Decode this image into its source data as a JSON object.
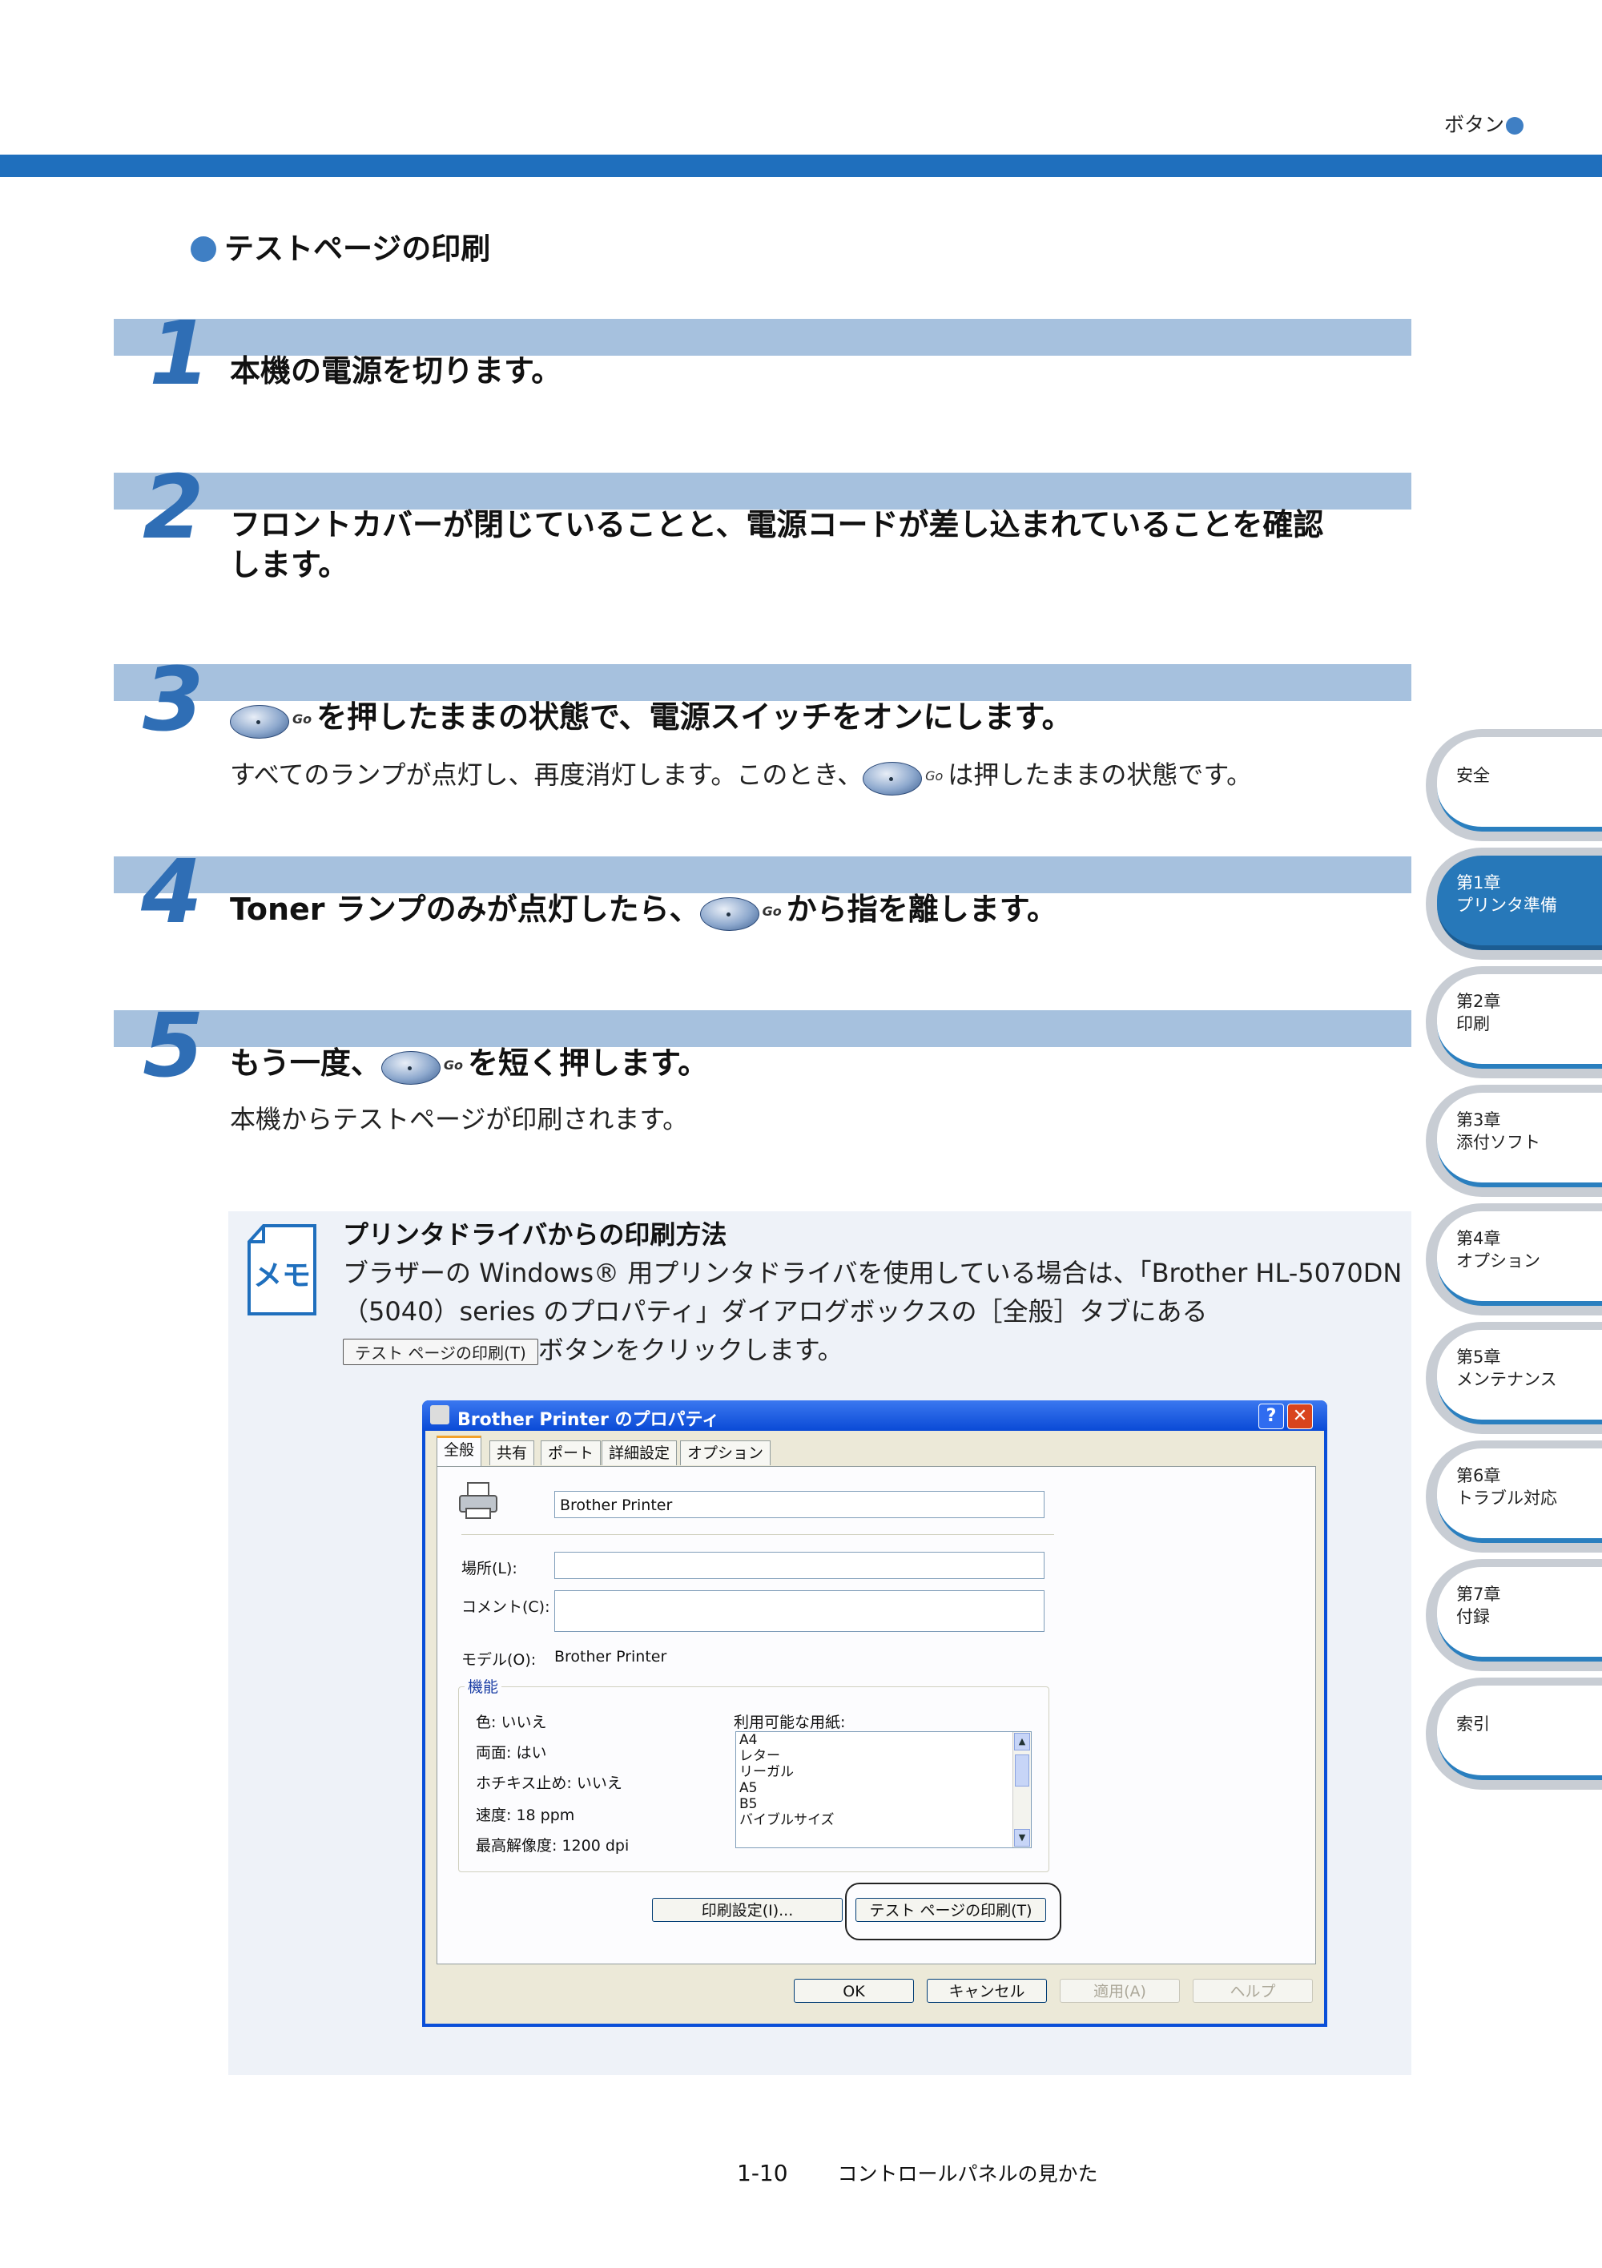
{
  "header": {
    "label": "ボタン"
  },
  "section": {
    "title": "テストページの印刷"
  },
  "steps": [
    {
      "num": "1",
      "title": "本機の電源を切ります。"
    },
    {
      "num": "2",
      "title": "フロントカバーが閉じていることと、電源コードが差し込まれていることを確認",
      "title_cont": "します。"
    },
    {
      "num": "3",
      "title": "を押したままの状態で、電源スイッチをオンにします。",
      "desc_a": "すべてのランプが点灯し、再度消灯します。このとき、",
      "desc_b": "は押したままの状態です。"
    },
    {
      "num": "4",
      "title_a": "Toner ランプのみが点灯したら、",
      "title_b": "から指を離します。"
    },
    {
      "num": "5",
      "title_a": "もう一度、",
      "title_b": "を短く押します。",
      "desc": "本機からテストページが印刷されます。"
    }
  ],
  "go_button": {
    "label": "Go"
  },
  "memo": {
    "icon_text": "メモ",
    "title": "プリンタドライバからの印刷方法",
    "line1": "ブラザーの Windows® 用プリンタドライバを使用している場合は、「Brother HL-5070DN",
    "line2": "（5040）series のプロパティ」ダイアログボックスの［全般］タブにある",
    "button_label": "テスト ページの印刷(T)",
    "line3": "ボタンをクリックします。"
  },
  "dialog": {
    "title": "Brother Printer のプロパティ",
    "help": "?",
    "close": "✕",
    "tabs": [
      "全般",
      "共有",
      "ポート",
      "詳細設定",
      "オプション"
    ],
    "printer_name": "Brother Printer",
    "location_label": "場所(L):",
    "comment_label": "コメント(C):",
    "model_label": "モデル(O):",
    "model_value": "Brother Printer",
    "features_title": "機能",
    "features": [
      "色: いいえ",
      "両面: はい",
      "ホチキス止め: いいえ",
      "速度: 18 ppm",
      "最高解像度: 1200 dpi"
    ],
    "paper_label": "利用可能な用紙:",
    "papers": [
      "A4",
      "レター",
      "リーガル",
      "A5",
      "B5",
      "バイブルサイズ"
    ],
    "btn_prefs": "印刷設定(I)...",
    "btn_test": "テスト ページの印刷(T)",
    "btn_ok": "OK",
    "btn_cancel": "キャンセル",
    "btn_apply": "適用(A)",
    "btn_help": "ヘルプ"
  },
  "side_tabs": [
    {
      "line1": "安全",
      "line2": ""
    },
    {
      "line1": "第1章",
      "line2": "プリンタ準備"
    },
    {
      "line1": "第2章",
      "line2": "印刷"
    },
    {
      "line1": "第3章",
      "line2": "添付ソフト"
    },
    {
      "line1": "第4章",
      "line2": "オプション"
    },
    {
      "line1": "第5章",
      "line2": "メンテナンス"
    },
    {
      "line1": "第6章",
      "line2": "トラブル対応"
    },
    {
      "line1": "第7章",
      "line2": "付録"
    },
    {
      "line1": "索引",
      "line2": ""
    }
  ],
  "footer": {
    "page": "1-10",
    "chapter": "コントロールパネルの見かた"
  }
}
